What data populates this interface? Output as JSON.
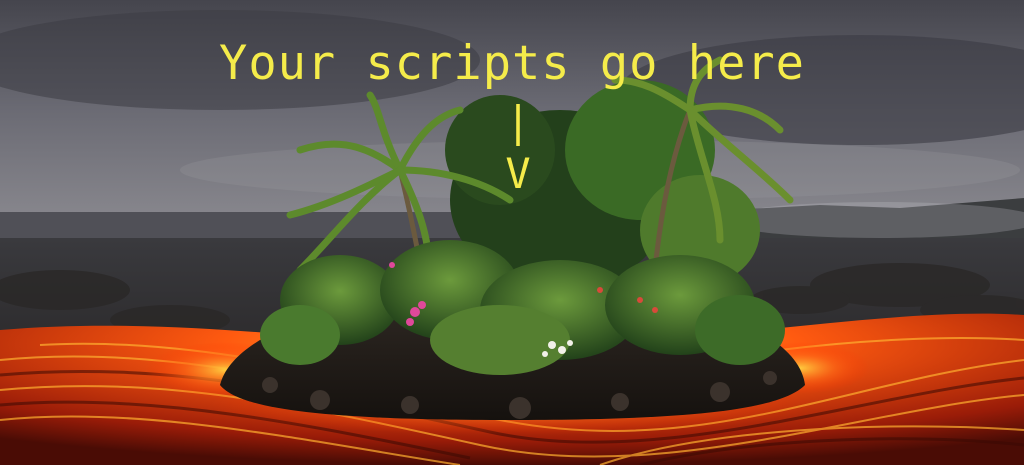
{
  "overlay": {
    "caption": "Your scripts go here",
    "arrow_bar": "|",
    "arrow_head": "V"
  },
  "colors": {
    "caption_text": "#f5ec4a",
    "sky": "#5a5a63",
    "lava": "#ff5a10",
    "rock": "#2b2622",
    "foliage": "#3d6b28"
  }
}
